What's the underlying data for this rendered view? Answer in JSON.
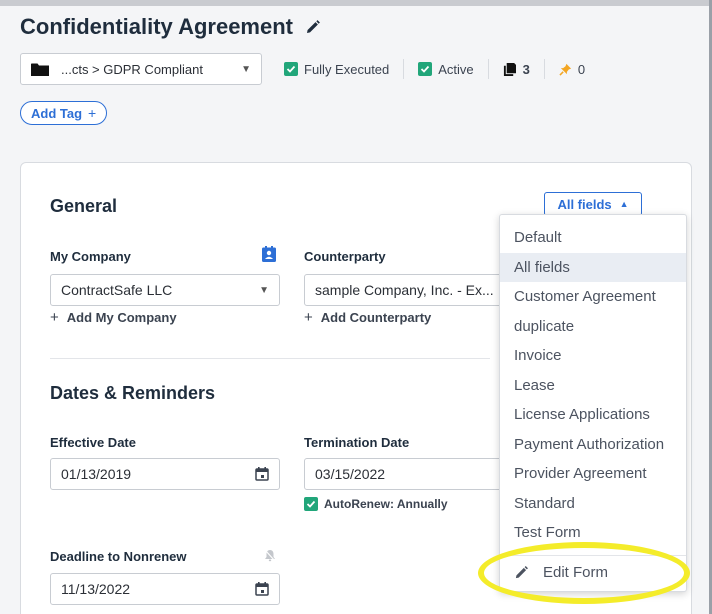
{
  "header": {
    "title": "Confidentiality Agreement",
    "folder_path": "...cts > GDPR Compliant",
    "status": {
      "executed_label": "Fully Executed",
      "active_label": "Active",
      "documents_count": "3",
      "pins_count": "0"
    },
    "add_tag_label": "Add Tag"
  },
  "general": {
    "heading": "General",
    "view_select_label": "All fields",
    "my_company": {
      "label": "My Company",
      "value": "ContractSafe LLC",
      "add_label": "Add My Company"
    },
    "counterparty": {
      "label": "Counterparty",
      "value": "sample Company, Inc. - Ex...",
      "add_label": "Add Counterparty"
    }
  },
  "dates": {
    "heading": "Dates & Reminders",
    "effective_date": {
      "label": "Effective Date",
      "value": "01/13/2019"
    },
    "termination_date": {
      "label": "Termination Date",
      "value": "03/15/2022"
    },
    "autorenew_label": "AutoRenew: Annually",
    "deadline": {
      "label": "Deadline to Nonrenew",
      "value": "11/13/2022"
    }
  },
  "form_menu": {
    "items": [
      "Default",
      "All fields",
      "Customer Agreement",
      "duplicate",
      "Invoice",
      "Lease",
      "License Applications",
      "Payment Authorization",
      "Provider Agreement",
      "Standard",
      "Test Form"
    ],
    "selected": "All fields",
    "edit_label": "Edit Form"
  },
  "colors": {
    "accent": "#2d6fd6",
    "check_green": "#21a67a",
    "highlight_yellow": "#f4ec2a"
  }
}
